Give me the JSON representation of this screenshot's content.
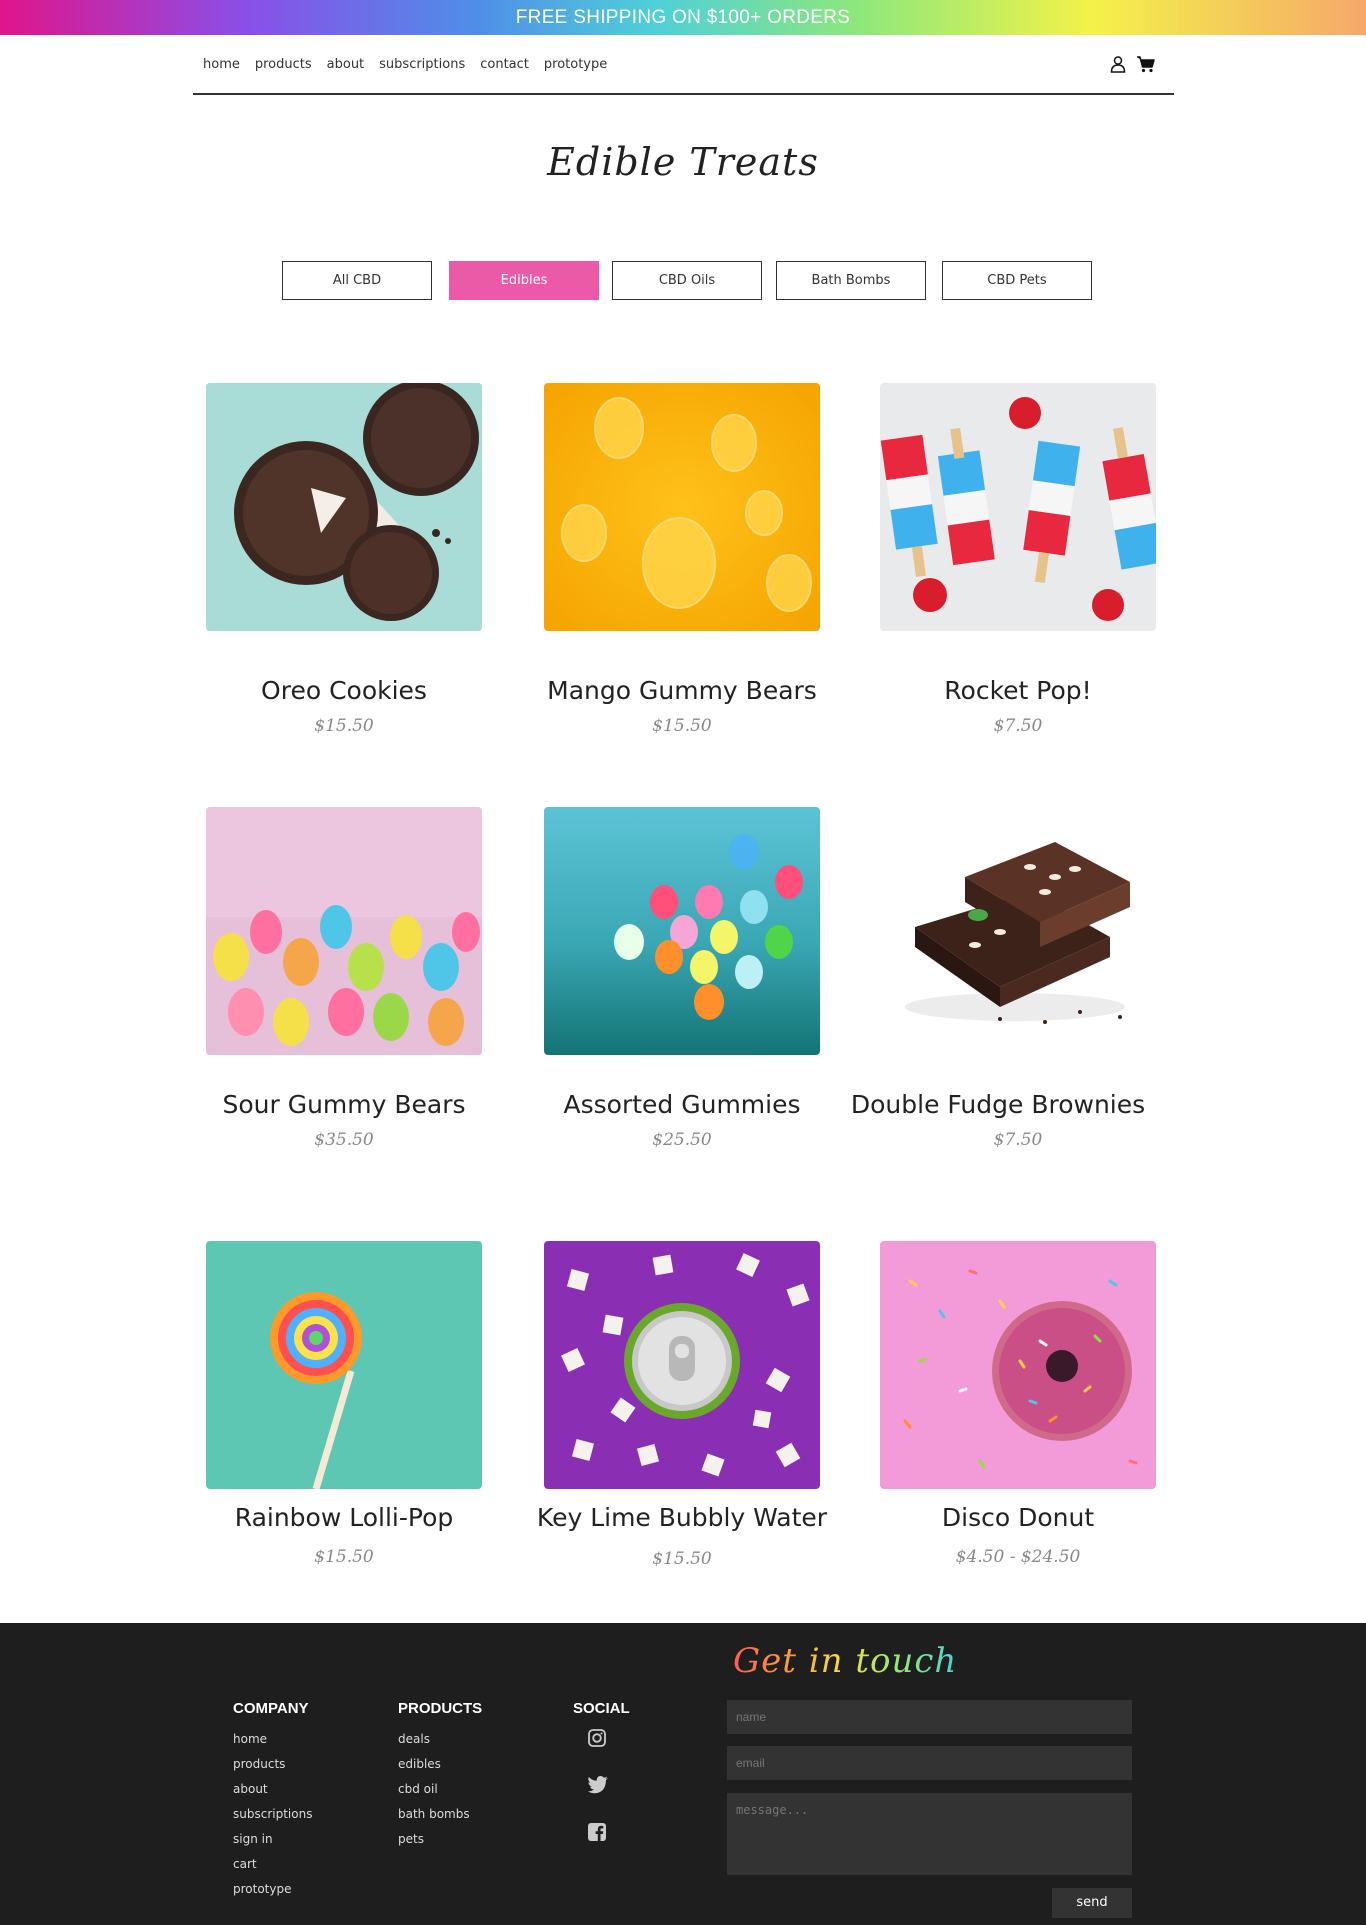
{
  "promo": {
    "text": "FREE SHIPPING ON $100+ ORDERS"
  },
  "nav": {
    "links": [
      "home",
      "products",
      "about",
      "subscriptions",
      "contact",
      "prototype"
    ],
    "icons": [
      "user-icon",
      "cart-icon"
    ]
  },
  "page": {
    "title": "Edible Treats"
  },
  "filters": [
    {
      "label": "All CBD",
      "active": false
    },
    {
      "label": "Edibles",
      "active": true
    },
    {
      "label": "CBD Oils",
      "active": false
    },
    {
      "label": "Bath Bombs",
      "active": false
    },
    {
      "label": "CBD Pets",
      "active": false
    }
  ],
  "products": [
    {
      "name": "Oreo Cookies",
      "price": "$15.50"
    },
    {
      "name": "Mango Gummy Bears",
      "price": "$15.50"
    },
    {
      "name": "Rocket Pop!",
      "price": "$7.50"
    },
    {
      "name": "Sour Gummy Bears",
      "price": "$35.50"
    },
    {
      "name": "Assorted Gummies",
      "price": "$25.50"
    },
    {
      "name": "Double Fudge Brownies",
      "price": "$7.50"
    },
    {
      "name": "Rainbow Lolli-Pop",
      "price": "$15.50"
    },
    {
      "name": "Key Lime Bubbly Water",
      "price": "$15.50"
    },
    {
      "name": "Disco Donut",
      "price": "$4.50 - $24.50"
    }
  ],
  "footer": {
    "company": {
      "heading": "COMPANY",
      "links": [
        "home",
        "products",
        "about",
        "subscriptions",
        "sign in",
        "cart",
        "prototype"
      ]
    },
    "products": {
      "heading": "PRODUCTS",
      "links": [
        "deals",
        "edibles",
        "cbd oil",
        "bath bombs",
        "pets"
      ]
    },
    "social": {
      "heading": "SOCIAL",
      "icons": [
        "instagram-icon",
        "twitter-icon",
        "facebook-icon"
      ]
    },
    "contact": {
      "heading": "Get in touch",
      "name_placeholder": "name",
      "email_placeholder": "email",
      "message_placeholder": "message...",
      "send_label": "send"
    }
  },
  "colors": {
    "accent": "#ea5aa7",
    "footer_bg": "#1e1e1e"
  }
}
